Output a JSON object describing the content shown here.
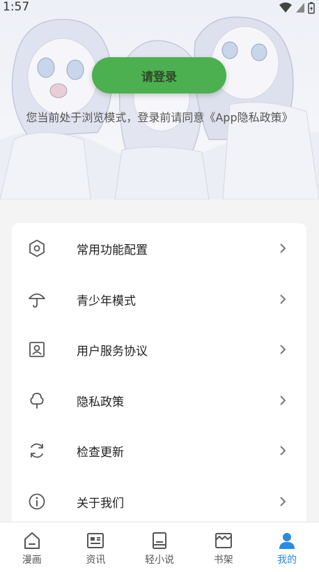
{
  "status_bar": {
    "time": "1:57"
  },
  "header": {
    "login_button": "请登录",
    "notice": "您当前处于浏览模式，登录前请同意《App隐私政策》"
  },
  "menu": {
    "items": [
      {
        "label": "常用功能配置",
        "icon": "hexagon-settings-icon"
      },
      {
        "label": "青少年模式",
        "icon": "umbrella-icon"
      },
      {
        "label": "用户服务协议",
        "icon": "user-card-icon"
      },
      {
        "label": "隐私政策",
        "icon": "tree-icon"
      },
      {
        "label": "检查更新",
        "icon": "refresh-icon"
      },
      {
        "label": "关于我们",
        "icon": "info-icon"
      }
    ]
  },
  "bottom_nav": {
    "items": [
      {
        "label": "漫画",
        "icon": "home-icon"
      },
      {
        "label": "资讯",
        "icon": "news-icon"
      },
      {
        "label": "轻小说",
        "icon": "book-icon"
      },
      {
        "label": "书架",
        "icon": "bookshelf-icon"
      },
      {
        "label": "我的",
        "icon": "person-icon",
        "active": true
      }
    ]
  },
  "colors": {
    "accent_green": "#4caf50",
    "active_blue": "#2a8be0"
  }
}
